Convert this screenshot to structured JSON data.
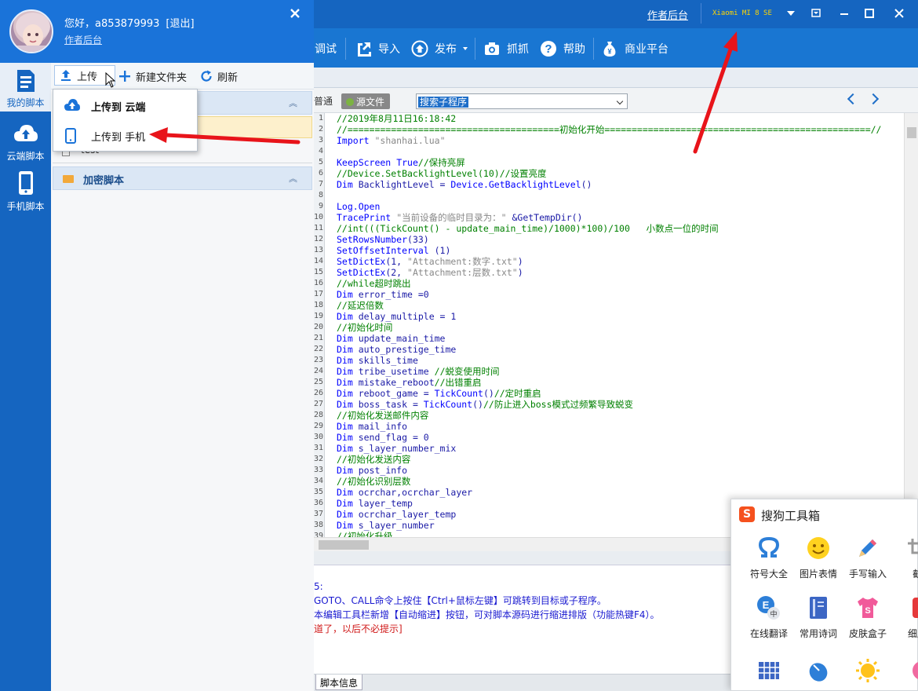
{
  "titlebar": {
    "backend_link": "作者后台",
    "device": "Xiaomi MI 8 SE"
  },
  "toolbar": {
    "debug": "调试",
    "import": "导入",
    "publish": "发布",
    "capture": "抓抓",
    "help": "帮助",
    "business": "商业平台"
  },
  "editor_toolbar": {
    "normal_fragment": "普通",
    "source_button": "源文件",
    "sub_search_value": "搜索子程序"
  },
  "code": [
    {
      "n": "1",
      "t": "//2019年8月11日16:18:42",
      "c": "cm"
    },
    {
      "n": "2",
      "t": "//=======================================初始化开始=================================================//",
      "c": "cm"
    },
    {
      "n": "3",
      "t": "Import \"shanhai.lua\"",
      "c": ""
    },
    {
      "n": "4",
      "t": "",
      "c": ""
    },
    {
      "n": "5",
      "t": "KeepScreen True//保持亮屏",
      "c": ""
    },
    {
      "n": "6",
      "t": "//Device.SetBacklightLevel(10)//设置亮度",
      "c": "cm"
    },
    {
      "n": "7",
      "t": "Dim BacklightLevel = Device.GetBacklightLevel()",
      "c": ""
    },
    {
      "n": "8",
      "t": "",
      "c": ""
    },
    {
      "n": "9",
      "t": "Log.Open",
      "c": ""
    },
    {
      "n": "10",
      "t": "TracePrint \"当前设备的临时目录为：\" &GetTempDir()",
      "c": ""
    },
    {
      "n": "11",
      "t": "//int(((TickCount() - update_main_time)/1000)*100)/100   小数点一位的时间",
      "c": "cm"
    },
    {
      "n": "12",
      "t": "SetRowsNumber(33)",
      "c": ""
    },
    {
      "n": "13",
      "t": "SetOffsetInterval (1)",
      "c": ""
    },
    {
      "n": "14",
      "t": "SetDictEx(1, \"Attachment:数字.txt\")",
      "c": ""
    },
    {
      "n": "15",
      "t": "SetDictEx(2, \"Attachment:层数.txt\")",
      "c": ""
    },
    {
      "n": "16",
      "t": "//while超时跳出",
      "c": "cm"
    },
    {
      "n": "17",
      "t": "Dim error_time =0",
      "c": ""
    },
    {
      "n": "18",
      "t": "//延迟倍数",
      "c": "cm"
    },
    {
      "n": "19",
      "t": "Dim delay_multiple = 1",
      "c": ""
    },
    {
      "n": "20",
      "t": "//初始化时间",
      "c": "cm"
    },
    {
      "n": "21",
      "t": "Dim update_main_time",
      "c": ""
    },
    {
      "n": "22",
      "t": "Dim auto_prestige_time",
      "c": ""
    },
    {
      "n": "23",
      "t": "Dim skills_time",
      "c": ""
    },
    {
      "n": "24",
      "t": "Dim tribe_usetime //蜕变使用时间",
      "c": ""
    },
    {
      "n": "25",
      "t": "Dim mistake_reboot//出错重启",
      "c": ""
    },
    {
      "n": "26",
      "t": "Dim reboot_game = TickCount()//定时重启",
      "c": ""
    },
    {
      "n": "27",
      "t": "Dim boss_task = TickCount()//防止进入boss模式过频繁导致蜕变",
      "c": ""
    },
    {
      "n": "28",
      "t": "//初始化发送邮件内容",
      "c": "cm"
    },
    {
      "n": "29",
      "t": "Dim mail_info",
      "c": ""
    },
    {
      "n": "30",
      "t": "Dim send_flag = 0",
      "c": ""
    },
    {
      "n": "31",
      "t": "Dim s_layer_number_mix",
      "c": ""
    },
    {
      "n": "32",
      "t": "//初始化发送内容",
      "c": "cm"
    },
    {
      "n": "33",
      "t": "Dim post_info",
      "c": ""
    },
    {
      "n": "34",
      "t": "//初始化识别层数",
      "c": "cm"
    },
    {
      "n": "35",
      "t": "Dim ocrchar,ocrchar_layer",
      "c": ""
    },
    {
      "n": "36",
      "t": "Dim layer_temp",
      "c": ""
    },
    {
      "n": "37",
      "t": "Dim ocrchar_layer_temp",
      "c": ""
    },
    {
      "n": "38",
      "t": "Dim s_layer_number",
      "c": ""
    },
    {
      "n": "39",
      "t": "//初始化升级",
      "c": "cm"
    }
  ],
  "output": {
    "line1": "5:",
    "line2": "GOTO、CALL命令上按住【Ctrl+鼠标左键】可跳转到目标或子程序。",
    "line3": "本编辑工具栏新增【自动缩进】按钮，可对脚本源码进行缩进排版（功能热键F4）。",
    "line4": "道了，以后不必提示]"
  },
  "status_tab": "脚本信息",
  "panel": {
    "greeting": "您好，a853879993",
    "logout": "[退出]",
    "author_backend": "作者后台",
    "nav": {
      "my_scripts": "我的脚本",
      "cloud_scripts": "云端脚本",
      "phone_scripts": "手机脚本"
    },
    "toolbar": {
      "upload": "上传",
      "new_folder": "新建文件夹",
      "refresh": "刷新"
    },
    "upload_menu": {
      "to_cloud": "上传到 云端",
      "to_phone": "上传到 手机"
    },
    "script_item": "test",
    "group_encrypted": "加密脚本"
  },
  "sogou": {
    "title": "搜狗工具箱",
    "items": [
      {
        "label": "符号大全",
        "icon": "omega-icon"
      },
      {
        "label": "图片表情",
        "icon": "smiley-icon"
      },
      {
        "label": "手写输入",
        "icon": "pencil-icon"
      },
      {
        "label": "截",
        "icon": "screenshot-icon"
      },
      {
        "label": "在线翻译",
        "icon": "translate-icon"
      },
      {
        "label": "常用诗词",
        "icon": "book-icon"
      },
      {
        "label": "皮肤盒子",
        "icon": "tshirt-icon"
      },
      {
        "label": "细胞",
        "icon": "cell-icon"
      }
    ]
  },
  "colors": {
    "titlebar": "#1565c0",
    "toolbar": "#1976d2",
    "annotation": "#e8141a",
    "device_text": "#ffd600"
  }
}
